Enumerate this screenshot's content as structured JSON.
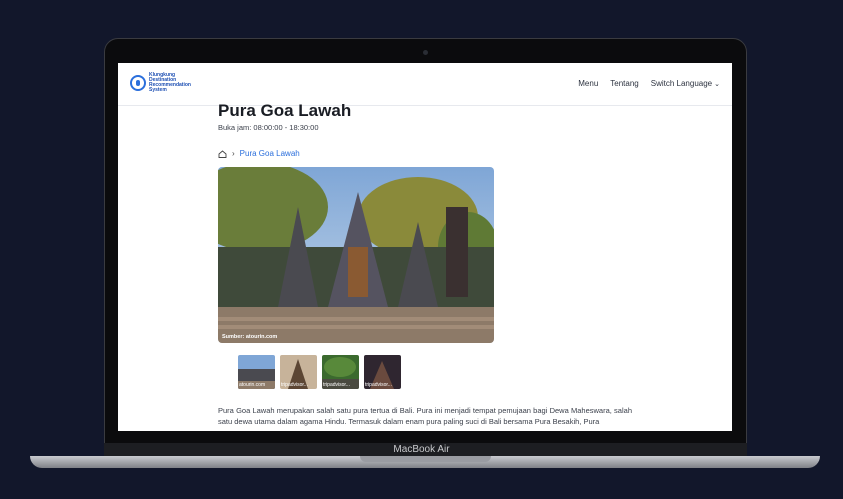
{
  "device": {
    "label": "MacBook Air"
  },
  "nav": {
    "logo_lines": [
      "Klungkung",
      "Destination",
      "Recommendation",
      "System"
    ],
    "links": [
      {
        "label": "Menu"
      },
      {
        "label": "Tentang"
      },
      {
        "label": "Switch Language"
      }
    ]
  },
  "page": {
    "title": "Pura Goa Lawah",
    "hours": "Buka jam: 08:00:00 - 18:30:00",
    "breadcrumb_current": "Pura Goa Lawah",
    "hero_caption": "Sumber: atourin.com",
    "thumbnails": [
      {
        "label": "atourin.com"
      },
      {
        "label": "tripadvisor..."
      },
      {
        "label": "tripadvisor..."
      },
      {
        "label": "tripadvisor..."
      }
    ],
    "description": "Pura Goa Lawah merupakan salah satu pura tertua di Bali. Pura ini menjadi tempat pemujaan bagi Dewa Maheswara, salah satu dewa utama dalam agama Hindu. Termasuk dalam enam pura paling suci di Bali bersama Pura Besakih, Pura"
  }
}
